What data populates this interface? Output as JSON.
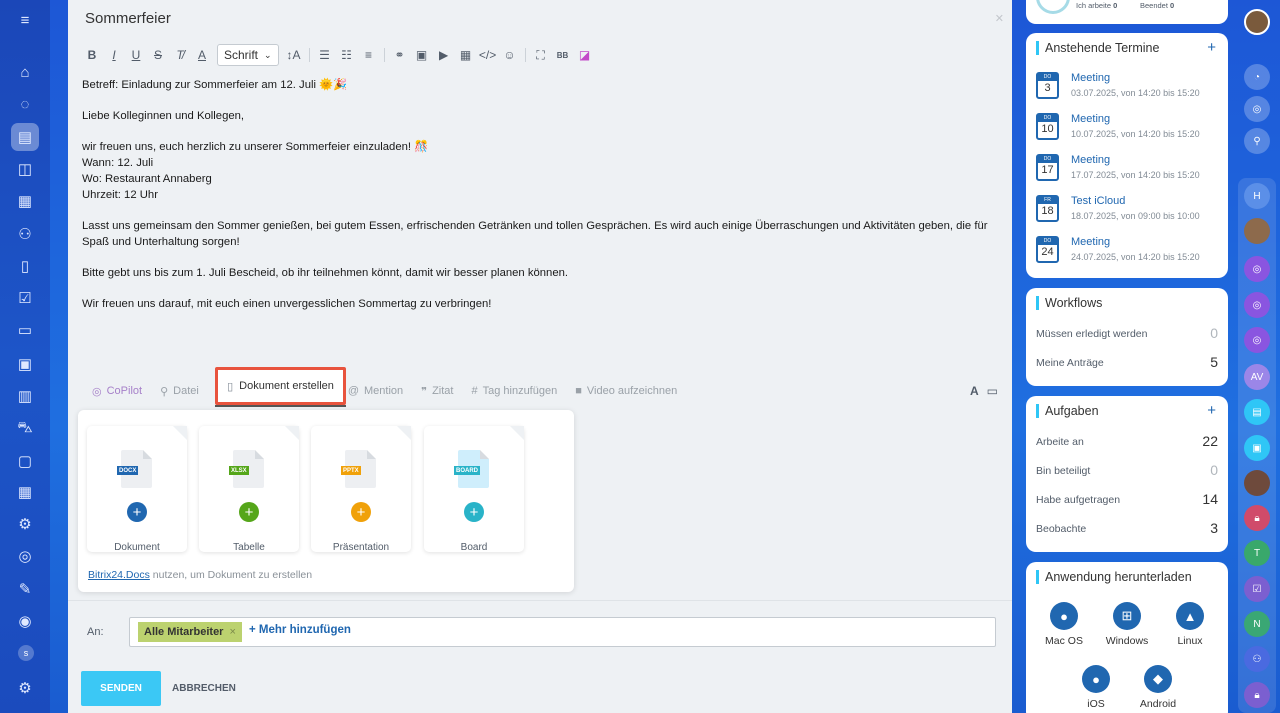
{
  "left_sidebar": {
    "icons": [
      "menu-icon",
      "home-icon",
      "feed-icon",
      "tasks-icon",
      "chat-icon",
      "calendar-icon",
      "team-icon",
      "documents-icon",
      "checklist-icon",
      "crm-icon",
      "sites-icon",
      "analytics-icon",
      "shop-icon",
      "inventory-icon",
      "booking-icon",
      "automation-icon",
      "marketing-icon",
      "signing-icon",
      "support-icon",
      "settings-icon"
    ],
    "badge": "s"
  },
  "editor": {
    "title": "Sommerfeier",
    "toolbar": {
      "font_select": "Schrift"
    },
    "body": [
      "Betreff: Einladung zur Sommerfeier am 12. Juli 🌞🎉",
      "Liebe Kolleginnen und Kollegen,",
      "wir freuen uns, euch herzlich zu unserer Sommerfeier einzuladen! 🎊",
      "Wann: 12. Juli",
      "Wo: Restaurant Annaberg",
      "Uhrzeit: 12 Uhr",
      "Lasst uns gemeinsam den Sommer genießen, bei gutem Essen, erfrischenden Getränken und tollen Gesprächen. Es wird auch einige Überraschungen und Aktivitäten geben, die für Spaß und Unterhaltung sorgen!",
      "Bitte gebt uns bis zum 1. Juli Bescheid, ob ihr teilnehmen könnt, damit wir besser planen können.",
      "Wir freuen uns darauf, mit euch einen unvergesslichen Sommertag zu verbringen!"
    ],
    "tabs": {
      "copilot": "CoPilot",
      "datei": "Datei",
      "dokument": "Dokument erstellen",
      "mention": "Mention",
      "zitat": "Zitat",
      "tag": "Tag hinzufügen",
      "video": "Video aufzeichnen"
    }
  },
  "doc_popup": {
    "cards": [
      {
        "label": "Dokument",
        "ext": "DOCX",
        "color": "#2067b0"
      },
      {
        "label": "Tabelle",
        "ext": "XLSX",
        "color": "#55a61a"
      },
      {
        "label": "Präsentation",
        "ext": "PPTX",
        "color": "#f0a10a"
      },
      {
        "label": "Board",
        "ext": "BOARD",
        "color": "#29b3c8"
      }
    ],
    "hint_link": "Bitrix24.Docs",
    "hint_text": " nutzen, um Dokument zu erstellen"
  },
  "recipients": {
    "label": "An:",
    "chip": "Alle Mitarbeiter",
    "more": "+ Mehr hinzufügen"
  },
  "actions": {
    "send": "SENDEN",
    "cancel": "ABBRECHEN"
  },
  "status": {
    "working": "Ich arbeite",
    "working_count": "0",
    "finished": "Beendet",
    "finished_count": "0"
  },
  "termine": {
    "title": "Anstehende Termine",
    "events": [
      {
        "dow": "DO",
        "day": "3",
        "title": "Meeting",
        "date": "03.07.2025, von 14:20 bis 15:20"
      },
      {
        "dow": "DO",
        "day": "10",
        "title": "Meeting",
        "date": "10.07.2025, von 14:20 bis 15:20"
      },
      {
        "dow": "DO",
        "day": "17",
        "title": "Meeting",
        "date": "17.07.2025, von 14:20 bis 15:20"
      },
      {
        "dow": "FR",
        "day": "18",
        "title": "Test iCloud",
        "date": "18.07.2025, von 09:00 bis 10:00"
      },
      {
        "dow": "DO",
        "day": "24",
        "title": "Meeting",
        "date": "24.07.2025, von 14:20 bis 15:20"
      }
    ]
  },
  "workflows": {
    "title": "Workflows",
    "rows": [
      {
        "label": "Müssen erledigt werden",
        "value": "0"
      },
      {
        "label": "Meine Anträge",
        "value": "5"
      }
    ]
  },
  "aufgaben": {
    "title": "Aufgaben",
    "rows": [
      {
        "label": "Arbeite an",
        "value": "22"
      },
      {
        "label": "Bin beteiligt",
        "value": "0"
      },
      {
        "label": "Habe aufgetragen",
        "value": "14"
      },
      {
        "label": "Beobachte",
        "value": "3"
      }
    ]
  },
  "download": {
    "title": "Anwendung herunterladen",
    "apps": [
      "Mac OS",
      "Windows",
      "Linux",
      "iOS",
      "Android"
    ]
  },
  "right_sidebar": {
    "labels": [
      "H",
      "AV",
      "T",
      "N"
    ]
  }
}
